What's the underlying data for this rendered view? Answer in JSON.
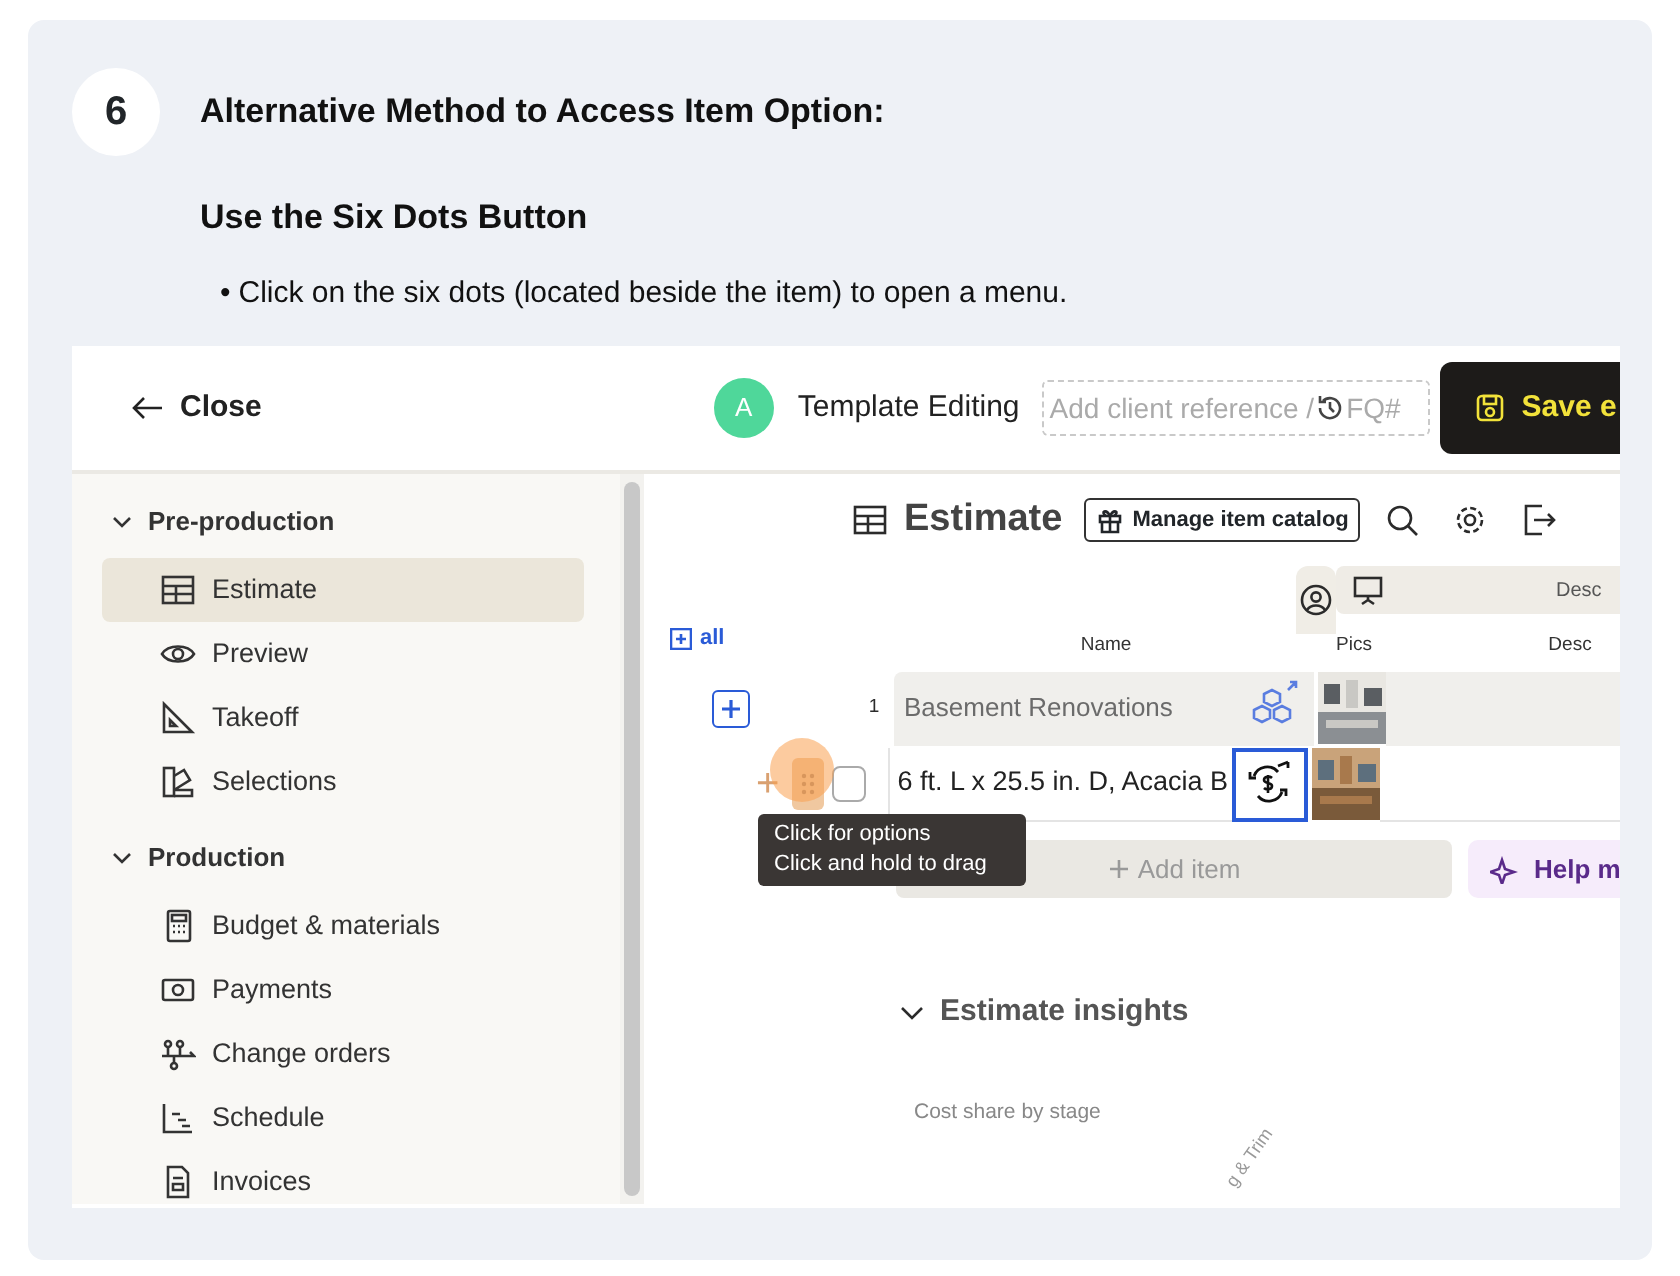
{
  "step": {
    "number": "6",
    "title": "Alternative Method to Access Item Option:",
    "subtitle": "Use the Six Dots Button",
    "bullets": [
      {
        "marker": "•",
        "text": "Click on the six dots (located beside the item) to open a menu."
      }
    ]
  },
  "topbar": {
    "close": "Close",
    "avatar": "A",
    "title": "Template Editing",
    "reference_field": {
      "placeholder": "Add client reference /",
      "placeholder_tail": "FQ#"
    },
    "save_button": "Save e"
  },
  "sidebar": {
    "sections": [
      {
        "label": "Pre-production",
        "expanded": true,
        "items": [
          {
            "label": "Estimate",
            "kind": "table",
            "selected": true
          },
          {
            "label": "Preview",
            "kind": "eye",
            "selected": false
          },
          {
            "label": "Takeoff",
            "kind": "ruler",
            "selected": false
          },
          {
            "label": "Selections",
            "kind": "swatch",
            "selected": false
          }
        ]
      },
      {
        "label": "Production",
        "expanded": true,
        "items": [
          {
            "label": "Budget & materials",
            "kind": "calculator",
            "selected": false
          },
          {
            "label": "Payments",
            "kind": "money",
            "selected": false
          },
          {
            "label": "Change orders",
            "kind": "flow",
            "selected": false
          },
          {
            "label": "Schedule",
            "kind": "schedule",
            "selected": false
          },
          {
            "label": "Invoices",
            "kind": "document",
            "selected": false
          }
        ]
      }
    ]
  },
  "estimate": {
    "title": "Estimate",
    "catalog_button": "Manage item catalog",
    "view_bar_label": "Desc",
    "expand_all": "all",
    "columns": [
      "Name",
      "Pics",
      "Desc"
    ],
    "rows": [
      {
        "kind": "group",
        "number": "1",
        "name": "Basement Renovations"
      },
      {
        "kind": "item",
        "add_symbol": "+",
        "name": "6 ft. L x 25.5 in. D, Acacia B",
        "checked": false
      }
    ],
    "tooltip": [
      "Click for options",
      "Click and hold to drag"
    ],
    "add_item": "Add item",
    "help_button": "Help m",
    "insights": {
      "title": "Estimate insights",
      "expanded": true,
      "chart_title": "Cost share by stage",
      "axis_label": "g & Trim"
    }
  }
}
